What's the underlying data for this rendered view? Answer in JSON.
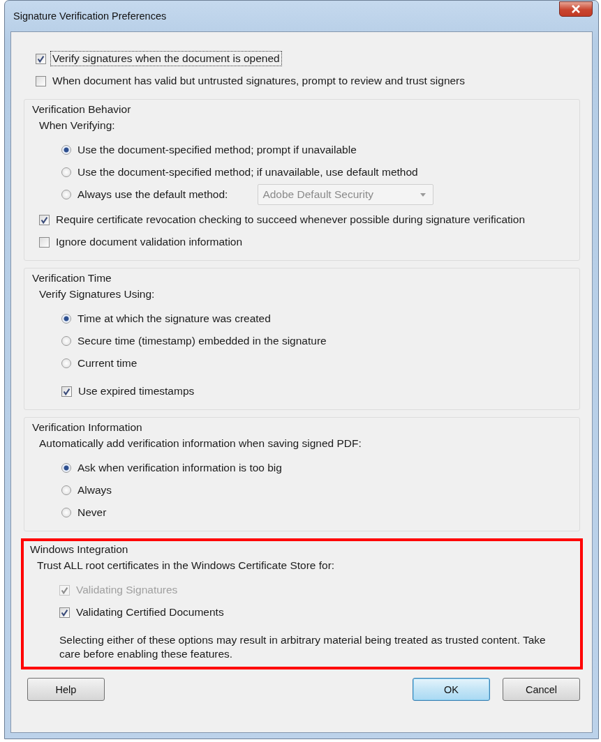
{
  "window": {
    "title": "Signature Verification Preferences"
  },
  "top_options": [
    {
      "label": "Verify signatures when the document is opened",
      "checked": true,
      "focused": true
    },
    {
      "label": "When document has valid but untrusted signatures, prompt to review and trust signers",
      "checked": false,
      "focused": false
    }
  ],
  "groups": [
    {
      "title": "Verification Behavior",
      "subtitle": "When Verifying:",
      "highlighted": false,
      "options": [
        {
          "kind": "radio",
          "label": "Use the document-specified method; prompt if unavailable",
          "selected": true
        },
        {
          "kind": "radio",
          "label": "Use the document-specified method; if unavailable, use default method",
          "selected": false
        },
        {
          "kind": "radio",
          "label": "Always use the default method:",
          "selected": false,
          "select": {
            "value": "Adobe Default Security",
            "disabled": true
          }
        }
      ],
      "checkboxes": [
        {
          "label": "Require certificate revocation checking to succeed whenever possible during signature verification",
          "checked": true
        },
        {
          "label": "Ignore document validation information",
          "checked": false
        }
      ]
    },
    {
      "title": "Verification Time",
      "subtitle": "Verify Signatures Using:",
      "highlighted": false,
      "options": [
        {
          "kind": "radio",
          "label": "Time at which the signature was created",
          "selected": true
        },
        {
          "kind": "radio",
          "label": "Secure time (timestamp) embedded in the signature",
          "selected": false
        },
        {
          "kind": "radio",
          "label": "Current time",
          "selected": false
        },
        {
          "kind": "checkbox",
          "label": "Use expired timestamps",
          "checked": true,
          "disabled": false
        }
      ]
    },
    {
      "title": "Verification Information",
      "subtitle": "Automatically add verification information when saving signed PDF:",
      "highlighted": false,
      "options": [
        {
          "kind": "radio",
          "label": "Ask when verification information is too big",
          "selected": true
        },
        {
          "kind": "radio",
          "label": "Always",
          "selected": false
        },
        {
          "kind": "radio",
          "label": "Never",
          "selected": false
        }
      ]
    },
    {
      "title": "Windows Integration",
      "subtitle": "Trust ALL root certificates in the Windows Certificate Store for:",
      "highlighted": true,
      "options": [
        {
          "kind": "checkbox",
          "label": "Validating Signatures",
          "checked": true,
          "disabled": true
        },
        {
          "kind": "checkbox",
          "label": "Validating Certified Documents",
          "checked": true,
          "disabled": false
        }
      ],
      "note": "Selecting either of these options may result in arbitrary material being treated as trusted content. Take care before enabling these features."
    }
  ],
  "buttons": [
    {
      "label": "Help",
      "kind": "secondary"
    },
    {
      "label": "OK",
      "kind": "default"
    },
    {
      "label": "Cancel",
      "kind": "secondary"
    }
  ]
}
